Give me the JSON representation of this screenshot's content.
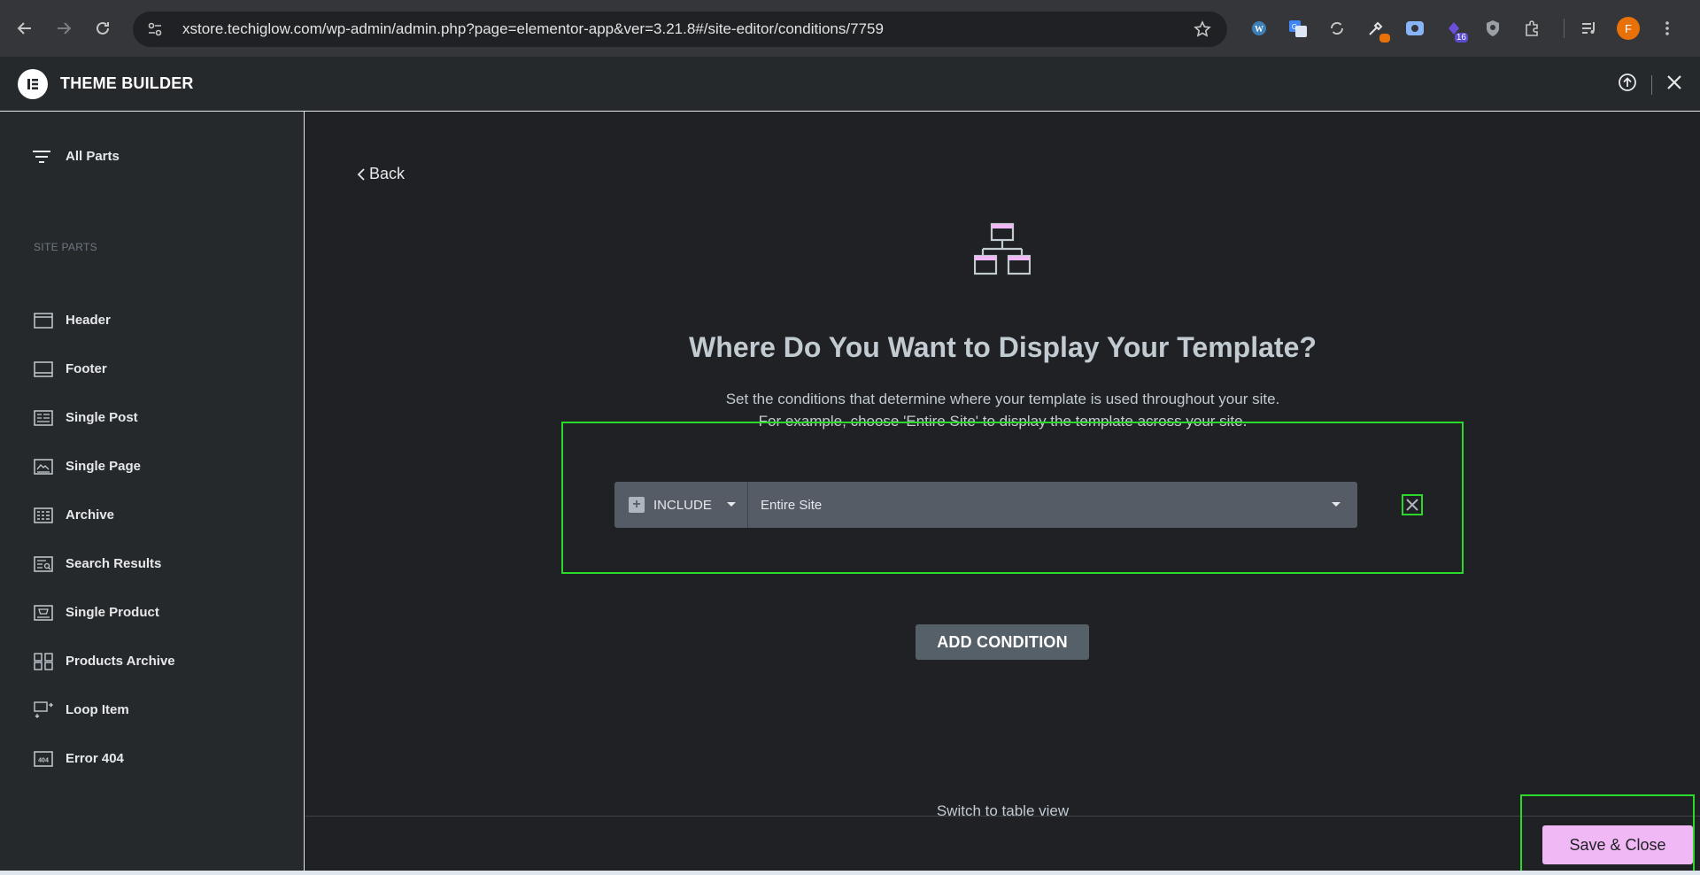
{
  "browser": {
    "url": "xstore.techiglow.com/wp-admin/admin.php?page=elementor-app&ver=3.21.8#/site-editor/conditions/7759",
    "extension_badge": "16",
    "profile_initial": "F"
  },
  "header": {
    "title": "THEME BUILDER"
  },
  "sidebar": {
    "all_parts": "All Parts",
    "section_title": "SITE PARTS",
    "items": [
      {
        "label": "Header",
        "icon": "header-icon"
      },
      {
        "label": "Footer",
        "icon": "footer-icon"
      },
      {
        "label": "Single Post",
        "icon": "single-post-icon"
      },
      {
        "label": "Single Page",
        "icon": "single-page-icon"
      },
      {
        "label": "Archive",
        "icon": "archive-icon"
      },
      {
        "label": "Search Results",
        "icon": "search-results-icon"
      },
      {
        "label": "Single Product",
        "icon": "single-product-icon"
      },
      {
        "label": "Products Archive",
        "icon": "products-archive-icon"
      },
      {
        "label": "Loop Item",
        "icon": "loop-item-icon"
      },
      {
        "label": "Error 404",
        "icon": "error-404-icon"
      }
    ]
  },
  "main": {
    "back_label": "Back",
    "heading": "Where Do You Want to Display Your Template?",
    "sub_line1": "Set the conditions that determine where your template is used throughout your site.",
    "sub_line2": "For example, choose 'Entire Site' to display the template across your site.",
    "condition": {
      "type": "INCLUDE",
      "value": "Entire Site"
    },
    "add_condition": "ADD CONDITION",
    "switch_view": "Switch to table view",
    "save_close": "Save & Close"
  },
  "colors": {
    "accent": "#f0b9f5",
    "highlight": "#2bd92b",
    "background": "#1f2124"
  }
}
